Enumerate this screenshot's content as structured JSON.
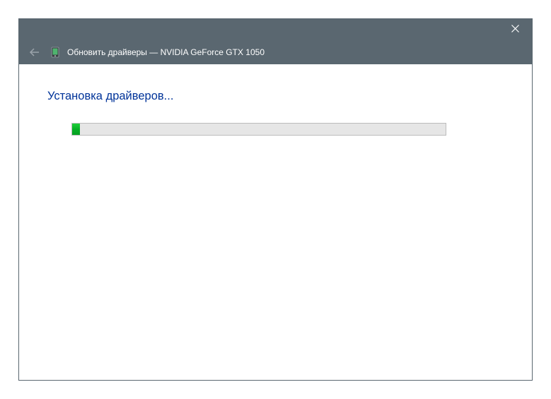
{
  "window": {
    "title": "Обновить драйверы — NVIDIA GeForce GTX 1050"
  },
  "content": {
    "heading": "Установка драйверов...",
    "progress_percent": 2
  }
}
